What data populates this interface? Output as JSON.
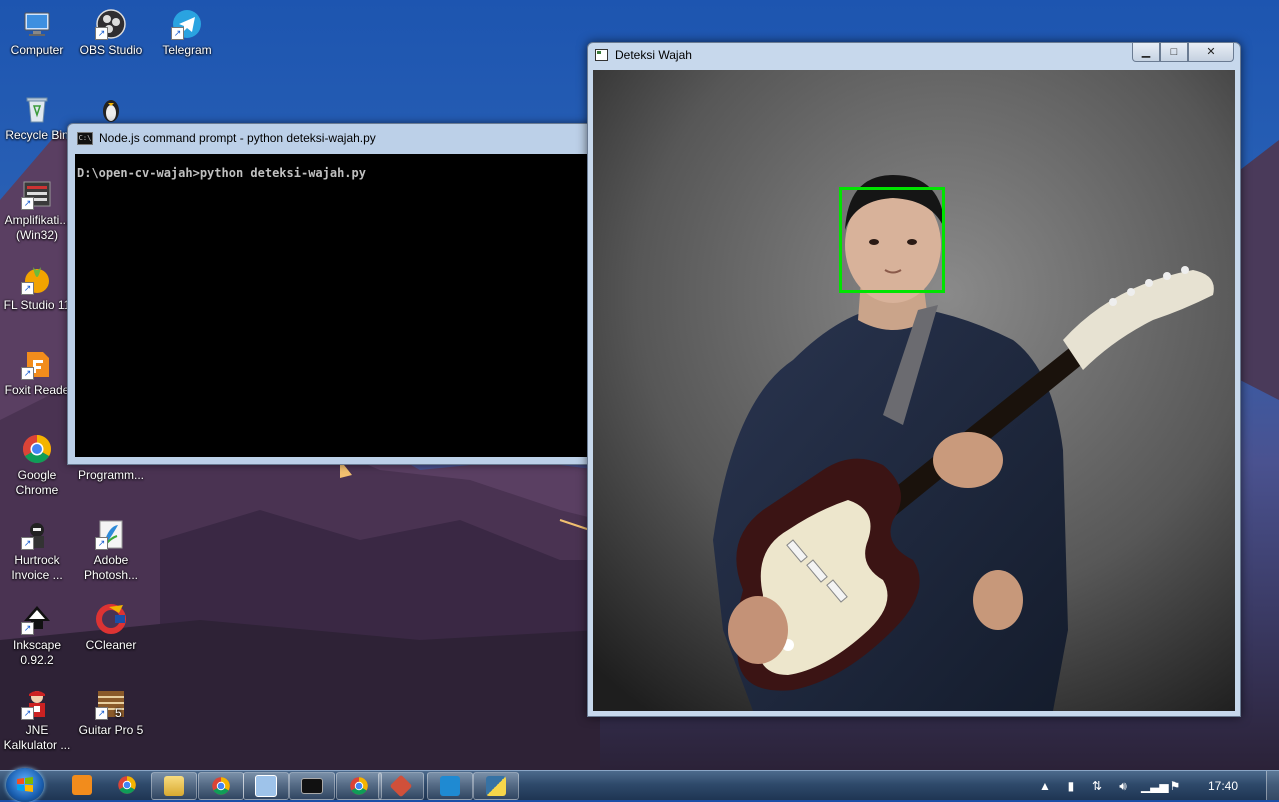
{
  "desktop_icons": [
    {
      "label": "Computer",
      "icon": "computer-icon"
    },
    {
      "label": "OBS Studio",
      "icon": "obs-icon"
    },
    {
      "label": "Telegram",
      "icon": "telegram-icon"
    },
    {
      "label": "Recycle Bin",
      "icon": "recycle-bin-icon"
    },
    {
      "label": "Amplifikati...\n(Win32)",
      "icon": "amplifikasi-icon"
    },
    {
      "label": "FL Studio 11",
      "icon": "fl-studio-icon"
    },
    {
      "label": "Foxit Reade",
      "icon": "foxit-reader-icon"
    },
    {
      "label": "Google\nChrome",
      "icon": "chrome-icon"
    },
    {
      "label": "Programm...",
      "icon": "programmer-icon"
    },
    {
      "label": "Hurtrock\nInvoice ...",
      "icon": "hurtrock-icon"
    },
    {
      "label": "Adobe\nPhotosh...",
      "icon": "photoshop-icon"
    },
    {
      "label": "Inkscape\n0.92.2",
      "icon": "inkscape-icon"
    },
    {
      "label": "CCleaner",
      "icon": "ccleaner-icon"
    },
    {
      "label": "JNE\nKalkulator ...",
      "icon": "jne-icon"
    },
    {
      "label": "Guitar Pro 5",
      "icon": "guitar-pro-icon"
    }
  ],
  "console_window": {
    "title": "Node.js command prompt - python  deteksi-wajah.py",
    "command_line": "D:\\open-cv-wajah>python deteksi-wajah.py"
  },
  "image_window": {
    "title": "Deteksi Wajah",
    "minimize": "▁",
    "maximize": "□",
    "close": "✕"
  },
  "taskbar": {
    "buttons": [
      {
        "icon": "media-player-icon"
      },
      {
        "icon": "chrome-icon"
      },
      {
        "icon": "file-explorer-icon"
      },
      {
        "icon": "chrome-icon"
      },
      {
        "icon": "control-panel-icon"
      },
      {
        "icon": "command-prompt-icon"
      },
      {
        "icon": "chrome-icon"
      },
      {
        "icon": "git-icon"
      },
      {
        "icon": "vscode-icon"
      },
      {
        "icon": "python-icon"
      }
    ],
    "clock": "17:40"
  }
}
